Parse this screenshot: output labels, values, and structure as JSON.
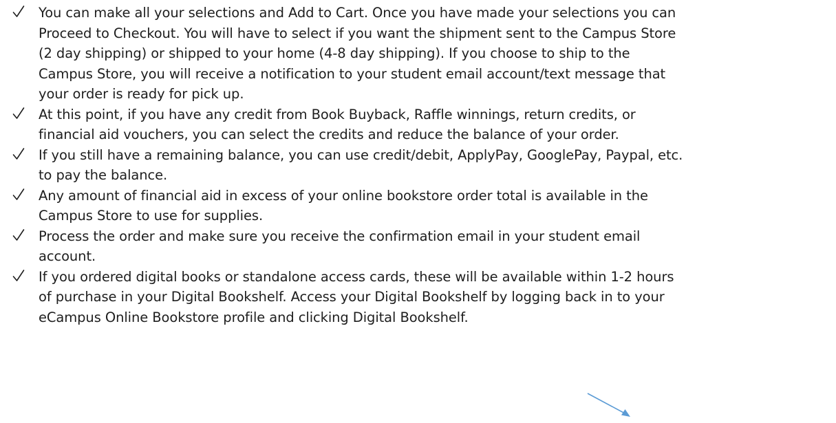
{
  "bullet_icon": "check-mark-icon",
  "bullets": [
    {
      "lines": [
        "You can make all your selections and Add to Cart.  Once you have made your selections you can",
        "Proceed to Checkout.  You will have to select if you want the shipment sent to the Campus Store",
        "(2 day shipping) or shipped to your home (4-8 day shipping).  If you choose to ship to the",
        "Campus Store, you will receive a notification to your student email account/text message that",
        "your order is ready for pick up."
      ]
    },
    {
      "lines": [
        "At this point, if you have any credit from Book Buyback, Raffle winnings, return credits, or",
        "financial aid vouchers, you can select the credits and reduce the balance of your order."
      ]
    },
    {
      "lines": [
        "If you still have a remaining balance, you can use credit/debit, ApplyPay, GooglePay, Paypal, etc.",
        "to pay the balance."
      ]
    },
    {
      "lines": [
        "Any amount of financial aid in excess of your online bookstore order total is available in the",
        "Campus Store to use for supplies."
      ]
    },
    {
      "lines": [
        "Process the order and make sure you receive the confirmation email in your student email",
        "account."
      ]
    },
    {
      "lines": [
        "If you ordered digital books or standalone access cards, these will be available within 1-2 hours",
        "of purchase in your Digital Bookshelf.  Access your Digital Bookshelf by logging back in to your",
        "eCampus Online Bookstore profile and clicking Digital Bookshelf."
      ]
    }
  ],
  "colors": {
    "text": "#1e1e1e",
    "arrow": "#5b9bd5"
  }
}
